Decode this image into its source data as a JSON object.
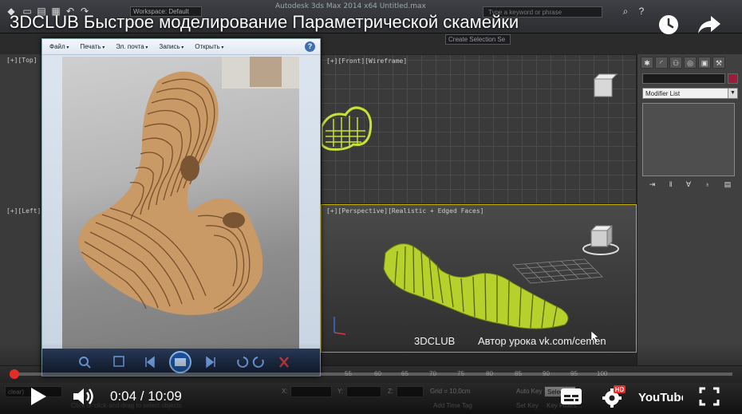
{
  "video": {
    "title": "3DCLUB Быстрое моделирование Параметрической скамейки",
    "current_time": "0:04",
    "separator": "/",
    "duration": "10:09",
    "progress_fraction": 0.007,
    "hd_badge": "HD",
    "logo_text": "YouTube",
    "accent_color": "#e52d27"
  },
  "max_app": {
    "window_title": "Autodesk 3ds Max 2014 x64    Untitled.max",
    "workspace": "Workspace: Default",
    "search_placeholder": "Type a keyword or phrase",
    "selection_set": "Create Selection Se",
    "viewports": {
      "top_label": "[+][Top]",
      "left_label": "[+][Left]",
      "front_label": "[+][Front][Wireframe]",
      "perspective_label": "[+][Perspective][Realistic + Edged Faces]"
    },
    "command_panel": {
      "modifier_list": "Modifier List"
    },
    "trackbar_ticks": [
      "55",
      "60",
      "65",
      "70",
      "75",
      "80",
      "85",
      "90",
      "95",
      "100"
    ],
    "status": {
      "maxscript": "clear)",
      "prompt": "Click or click-and-drag to select objects",
      "x_label": "X:",
      "y_label": "Y:",
      "z_label": "Z:",
      "grid": "Grid = 10,0cm",
      "auto_key": "Auto Key",
      "selected": "Selected",
      "set_key": "Set Key",
      "key_filters": "Key Filters...",
      "add_time_tag": "Add Time Tag"
    }
  },
  "image_viewer": {
    "menu": [
      "Файл",
      "Печать",
      "Эл. почта",
      "Запись",
      "Открыть"
    ],
    "help": "?"
  },
  "watermark": {
    "brand": "3DCLUB",
    "author": "Автор урока vk.com/cemen"
  }
}
